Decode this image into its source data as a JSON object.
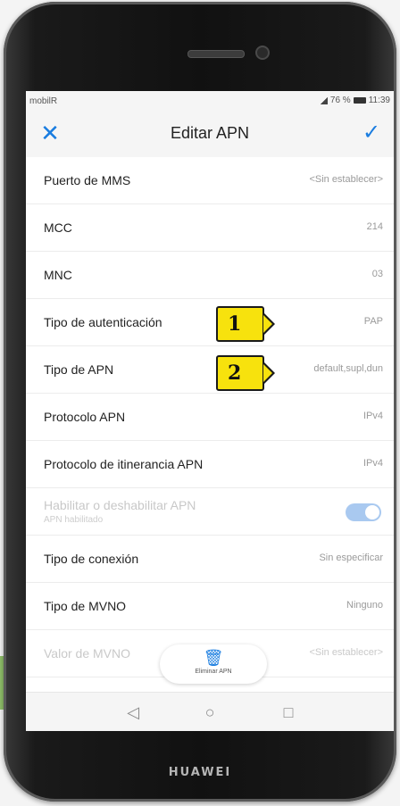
{
  "status_bar": {
    "carrier": "mobilR",
    "right_text": "76 %",
    "time": "11:39"
  },
  "app_bar": {
    "title": "Editar APN",
    "close_icon": "close-icon",
    "confirm_icon": "check-icon"
  },
  "rows": [
    {
      "label": "Puerto de MMS",
      "value": "<Sin establecer>"
    },
    {
      "label": "MCC",
      "value": "214"
    },
    {
      "label": "MNC",
      "value": "03"
    },
    {
      "label": "Tipo de autenticación",
      "value": "PAP"
    },
    {
      "label": "Tipo de APN",
      "value": "default,supl,dun"
    },
    {
      "label": "Protocolo APN",
      "value": "IPv4"
    },
    {
      "label": "Protocolo de itinerancia APN",
      "value": "IPv4"
    },
    {
      "label": "Habilitar o deshabilitar APN",
      "sub": "APN habilitado",
      "toggle_on": true,
      "disabled": true
    },
    {
      "label": "Tipo de conexión",
      "value": "Sin especificar"
    },
    {
      "label": "Tipo de MVNO",
      "value": "Ninguno"
    },
    {
      "label": "Valor de MVNO",
      "value": "<Sin establecer>",
      "faded": true
    }
  ],
  "callouts": [
    {
      "number": "1"
    },
    {
      "number": "2"
    }
  ],
  "delete_button": {
    "label": "Eliminar APN",
    "icon": "trash-icon"
  },
  "nav": {
    "back_icon": "back-triangle-icon",
    "home_icon": "home-circle-icon",
    "recents_icon": "recents-square-icon"
  },
  "device_brand": "HUAWEI",
  "colors": {
    "accent": "#1a7de0",
    "callout": "#f7e20d",
    "toggle": "#a9c9f0"
  }
}
